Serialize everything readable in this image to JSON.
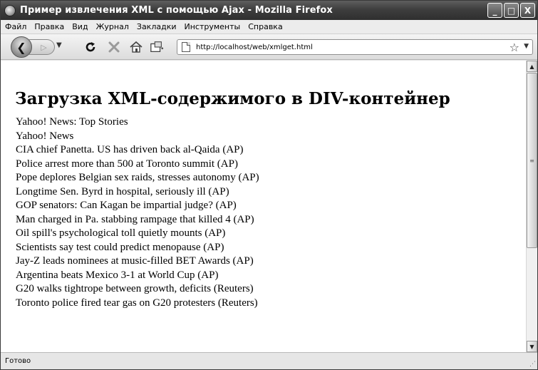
{
  "window": {
    "title": "Пример извлечения XML с помощью Ajax - Mozilla Firefox",
    "buttons": {
      "minimize": "_",
      "maximize": "□",
      "close": "X"
    }
  },
  "menu": [
    "Файл",
    "Правка",
    "Вид",
    "Журнал",
    "Закладки",
    "Инструменты",
    "Справка"
  ],
  "toolbar": {
    "back_icon": "back-arrow-icon",
    "forward_icon": "forward-arrow-icon",
    "reload_icon": "reload-icon",
    "stop_icon": "stop-icon",
    "home_icon": "home-icon",
    "bookmark_icon": "bookmark-add-icon"
  },
  "address_bar": {
    "url": "http://localhost/web/xmlget.html"
  },
  "page": {
    "heading": "Загрузка XML-содержимого в DIV-контейнер",
    "items": [
      "Yahoo! News: Top Stories",
      "Yahoo! News",
      "CIA chief Panetta. US has driven back al-Qaida (AP)",
      "Police arrest more than 500 at Toronto summit (AP)",
      "Pope deplores Belgian sex raids, stresses autonomy (AP)",
      "Longtime Sen. Byrd in hospital, seriously ill (AP)",
      "GOP senators: Can Kagan be impartial judge? (AP)",
      "Man charged in Pa. stabbing rampage that killed 4 (AP)",
      "Oil spill's psychological toll quietly mounts (AP)",
      "Scientists say test could predict menopause (AP)",
      "Jay-Z leads nominees at music-filled BET Awards (AP)",
      "Argentina beats Mexico 3-1 at World Cup (AP)",
      "G20 walks tightrope between growth, deficits (Reuters)",
      "Toronto police fired tear gas on G20 protesters (Reuters)"
    ]
  },
  "status": {
    "text": "Готово"
  }
}
